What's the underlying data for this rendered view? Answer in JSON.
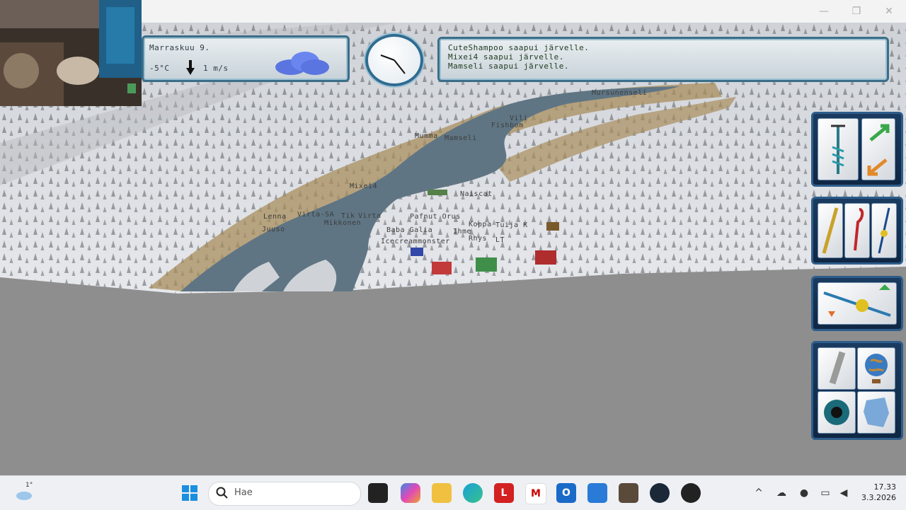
{
  "window": {
    "minimize": "—",
    "maximize": "❐",
    "close": "✕"
  },
  "weather": {
    "date": "Marraskuu 9.",
    "temperature": "-5°C",
    "wind_direction_icon": "arrow-down",
    "wind_speed": "1 m/s",
    "sky_icon": "cloud"
  },
  "news": {
    "lines": [
      "CuteShampoo saapui järvelle.",
      "Mixei4 saapui järvelle.",
      "Mamseli saapui järvelle."
    ]
  },
  "map_labels": [
    "Mursunenseli",
    "Vili",
    "Fishbom",
    "Mumma",
    "Mamseli",
    "Mixei4",
    "Naiscat",
    "Lenna",
    "Virta-SA",
    "Juuso",
    "Tik",
    "Virta",
    "Koppa",
    "Pafnut Orus",
    "Baba Galia",
    "Ihme",
    "Tuija K",
    "Icecreammonster",
    "Mikkonen",
    "Rhys",
    "LT"
  ],
  "tools": {
    "group1": [
      "ice-drill-icon",
      "swap-icon"
    ],
    "group2": [
      "rod-icon",
      "hook-icon",
      "lure-icon"
    ],
    "group3": [
      "jig-rod-icon"
    ],
    "group4": [
      "flashlight-icon",
      "globe-icon",
      "eye-icon",
      "map-icon"
    ]
  },
  "taskbar": {
    "weather_temp": "1°",
    "search_placeholder": "Hae",
    "time": "17.33",
    "date": "3.3.2026",
    "pinned": [
      "task-view",
      "copilot",
      "file-explorer",
      "edge",
      "lastpass",
      "mcafee",
      "outlook-new",
      "store",
      "character-app",
      "steam",
      "obs"
    ]
  },
  "colors": {
    "panel_border": "#3b6e89",
    "tray_bg": "#1a3b60",
    "water": "#5f7584",
    "snow": "#d8dbe0"
  }
}
